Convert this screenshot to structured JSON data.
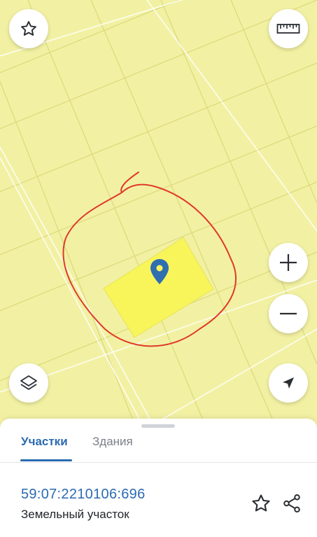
{
  "map": {
    "background_color": "#f2f1a3",
    "parcel_highlight_color": "#f7f55a",
    "annotation_color": "#e0392b",
    "marker_color": "#2f6fb0",
    "controls": {
      "favorite_icon": "star-icon",
      "ruler_icon": "ruler-icon",
      "zoom_in_icon": "plus-icon",
      "zoom_out_icon": "minus-icon",
      "layers_icon": "layers-icon",
      "locate_icon": "navigation-arrow-icon"
    }
  },
  "sheet": {
    "tabs": [
      {
        "label": "Участки",
        "active": true
      },
      {
        "label": "Здания",
        "active": false
      }
    ],
    "parcel": {
      "number": "59:07:2210106:696",
      "type": "Земельный участок"
    },
    "actions": {
      "favorite_icon": "star-icon",
      "share_icon": "share-icon"
    },
    "accent_color": "#2b6bb1"
  }
}
